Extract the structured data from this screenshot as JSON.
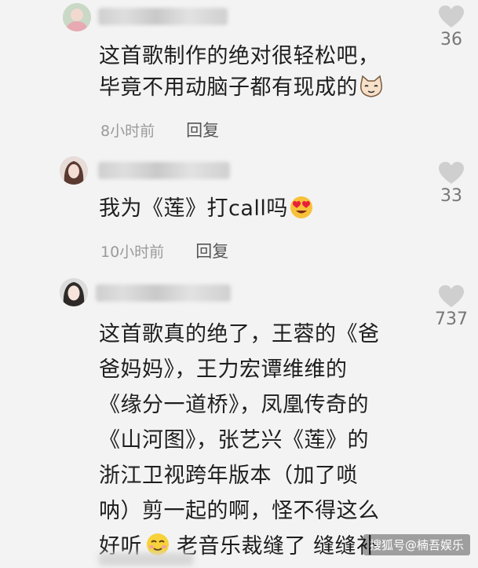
{
  "comments": [
    {
      "text_lines": [
        "这首歌制作的绝对很轻松吧，",
        "毕竟不用动脑子都有现成的"
      ],
      "time": "8小时前",
      "reply": "回复",
      "likes": "36"
    },
    {
      "text_lines": [
        "我为《莲》打call吗"
      ],
      "time": "10小时前",
      "reply": "回复",
      "likes": "33"
    },
    {
      "text_lines": [
        "这首歌真的绝了，王蓉的《爸",
        "爸妈妈》，王力宏谭维维的",
        "《缘分一道桥》，凤凰传奇的",
        "《山河图》，张艺兴《莲》的",
        "浙江卫视跨年版本（加了唢",
        "呐）剪一起的啊，怪不得这么",
        "好听",
        "老音乐裁缝了 缝缝补"
      ],
      "likes": "737"
    }
  ],
  "watermark": "搜狐号@楠吾娱乐"
}
